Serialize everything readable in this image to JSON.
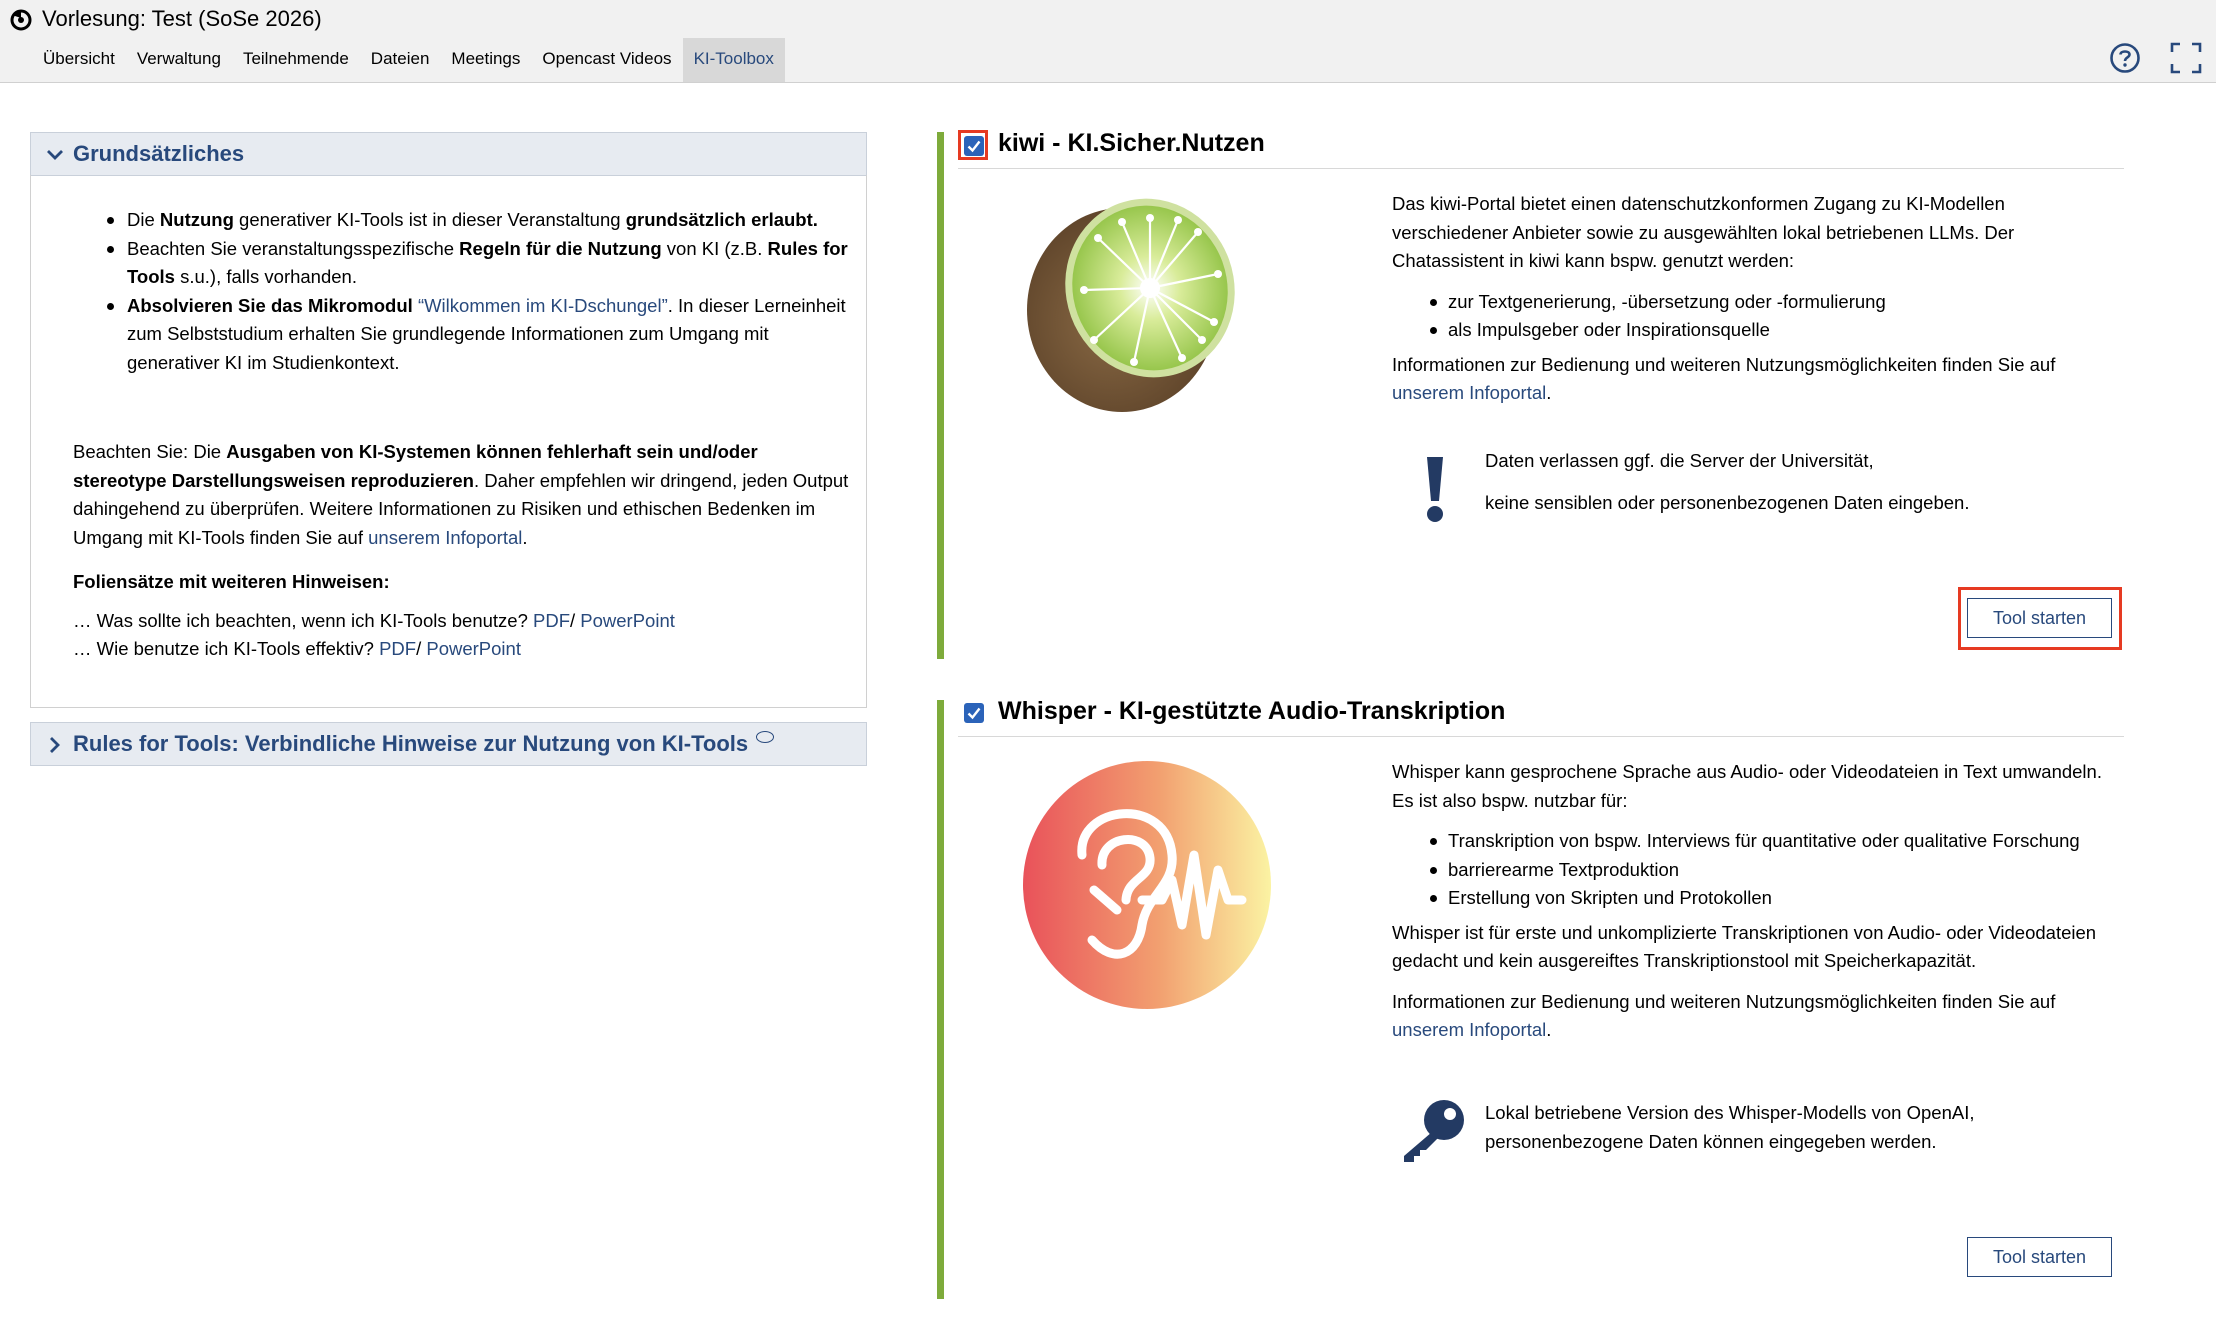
{
  "header": {
    "course_title": "Vorlesung: Test (SoSe 2026)",
    "nav": [
      "Übersicht",
      "Verwaltung",
      "Teilnehmende",
      "Dateien",
      "Meetings",
      "Opencast Videos",
      "KI-Toolbox"
    ],
    "active_tab": "KI-Toolbox"
  },
  "left": {
    "section1_title": "Grundsätzliches",
    "bullet1": {
      "a": "Die ",
      "b": "Nutzung",
      "c": " generativer KI-Tools ist in dieser Veranstaltung ",
      "d": "grundsätzlich erlaubt."
    },
    "bullet2": {
      "a": "Beachten Sie veranstaltungsspezifische ",
      "b": "Regeln für die Nutzung",
      "c": " von KI (z.B. ",
      "d": "Rules for Tools",
      "e": " s.u.), falls vorhanden."
    },
    "bullet3": {
      "a": "Absolvieren Sie das Mikromodul",
      "link": "“Wilkommen im KI-Dschungel”",
      "c": ". In dieser Lerneinheit zum Selbststudium erhalten Sie grundlegende Informationen zum Umgang mit generativer KI im Studienkontext."
    },
    "warning": {
      "a": "Beachten Sie: Die ",
      "b": "Ausgaben von KI-Systemen können fehlerhaft sein und/oder stereotype Darstellungsweisen reproduzieren",
      "c": ". Daher empfehlen wir dringend, jeden Output dahingehend zu überprüfen. Weitere Informationen zu Risiken und ethischen Bedenken im Umgang mit KI-Tools finden Sie auf ",
      "link": "unserem Infoportal",
      "d": "."
    },
    "slides_heading": "Foliensätze mit weiteren Hinweisen:",
    "slide1_text": "… Was sollte ich beachten, wenn ich KI-Tools benutze?",
    "slide2_text": "… Wie benutze ich KI-Tools effektiv?",
    "pdf_label": "PDF",
    "sep": "/",
    "ppt_label": "PowerPoint",
    "section2_title": "Rules for Tools: Verbindliche Hinweise zur Nutzung von KI-Tools"
  },
  "kiwi": {
    "checked": true,
    "title": "kiwi - KI.Sicher.Nutzen",
    "intro": "Das kiwi-Portal bietet einen datenschutzkonformen Zugang zu KI-Modellen verschiedener Anbieter sowie zu ausgewählten lokal betriebenen LLMs. Der Chatassistent in kiwi kann bspw. genutzt werden:",
    "bullets": [
      "zur Textgenerierung, -übersetzung oder -formulierung",
      "als Impulsgeber oder Inspirationsquelle"
    ],
    "info_text": "Informationen zur Bedienung und weiteren Nutzungsmöglichkeiten finden Sie auf ",
    "info_link": "unserem Infoportal",
    "info_end": ".",
    "note_line1": "Daten verlassen ggf. die Server der Universität,",
    "note_line2": "keine sensiblen oder personenbezogenen Daten eingeben.",
    "button": "Tool starten"
  },
  "whisper": {
    "checked": true,
    "title": "Whisper - KI-gestützte Audio-Transkription",
    "intro": "Whisper kann gesprochene Sprache aus Audio- oder Videodateien in Text umwandeln. Es ist also bspw. nutzbar für:",
    "bullets": [
      "Transkription von bspw. Interviews für quantitative oder qualitative Forschung",
      "barrierearme Textproduktion",
      "Erstellung von Skripten und Protokollen"
    ],
    "desc": "Whisper ist für erste und unkomplizierte Transkriptionen von Audio- oder Videodateien gedacht und kein ausgereiftes Transkriptionstool mit Speicherkapazität.",
    "info_text": "Informationen zur Bedienung und weiteren Nutzungsmöglichkeiten finden Sie auf ",
    "info_link": "unserem Infoportal",
    "info_end": ".",
    "note": "Lokal betriebene Version des Whisper-Modells von OpenAI, personenbezogene Daten können eingegeben werden.",
    "button": "Tool starten"
  },
  "icons": [
    "stud-ip-logo-icon",
    "help-icon",
    "fullscreen-icon",
    "chevron-down-icon",
    "chevron-right-icon",
    "external-link-icon",
    "checkbox-checked-icon",
    "kiwi-logo",
    "exclamation-icon",
    "whisper-ear-logo",
    "key-icon"
  ],
  "colors": {
    "accent": "#28497c",
    "card_bar": "#7eab3b",
    "checkbox": "#2b63b9",
    "highlight": "#e63a22"
  }
}
